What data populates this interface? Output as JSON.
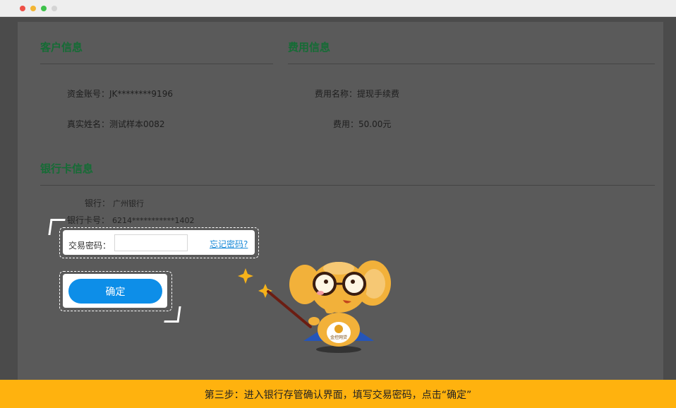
{
  "customer_section": {
    "title": "客户信息",
    "account_label": "资金账号：",
    "account_value": "JK********9196",
    "name_label": "真实姓名：",
    "name_value": "测试样本0082"
  },
  "fee_section": {
    "title": "费用信息",
    "fee_name_label": "费用名称：",
    "fee_name_value": "提现手续费",
    "fee_label": "费用：",
    "fee_value": "50.00元"
  },
  "bank_section": {
    "title": "银行卡信息",
    "bank_label": "银行：",
    "bank_value": "广州银行",
    "card_label": "银行卡号：",
    "card_value": "6214***********1402"
  },
  "password_form": {
    "label": "交易密码：",
    "value": "",
    "forgot_link": "忘记密码?"
  },
  "confirm_button": {
    "label": "确定"
  },
  "mascot": {
    "badge_text": "金控网贷"
  },
  "banner": {
    "text": "第三步：进入银行存管确认界面，填写交易密码，点击“确定”"
  },
  "colors": {
    "overlay_bg": "#5a5a5a",
    "section_title": "#156c35",
    "primary_button": "#0d8ee8",
    "link": "#1a8ad8",
    "banner_bg": "#ffb20e",
    "mascot_body": "#f2b13a"
  }
}
